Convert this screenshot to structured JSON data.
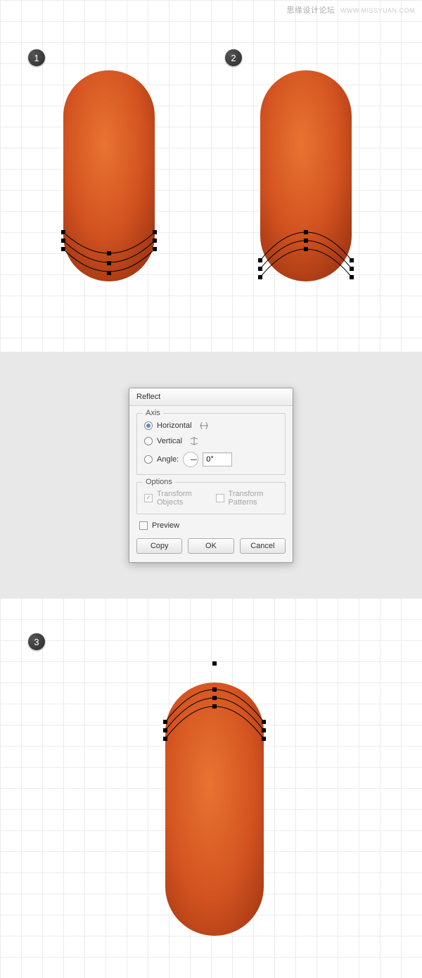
{
  "watermark": {
    "text": "思缘设计论坛",
    "url": "WWW.MISSYUAN.COM"
  },
  "steps": {
    "s1": "1",
    "s2": "2",
    "s3": "3"
  },
  "dialog": {
    "title": "Reflect",
    "axis": {
      "legend": "Axis",
      "horizontal": "Horizontal",
      "vertical": "Vertical",
      "angle_label": "Angle:",
      "angle_value": "0°",
      "selected": "horizontal"
    },
    "options": {
      "legend": "Options",
      "transform_objects": "Transform Objects",
      "transform_patterns": "Transform Patterns"
    },
    "preview": "Preview",
    "buttons": {
      "copy": "Copy",
      "ok": "OK",
      "cancel": "Cancel"
    }
  },
  "shape": {
    "color_mid": "#d35320",
    "color_dark": "#a63914",
    "color_hi": "#e87432"
  }
}
